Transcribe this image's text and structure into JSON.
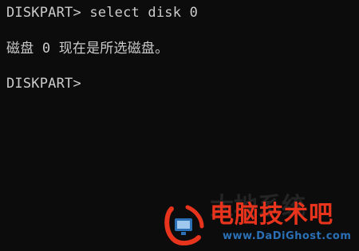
{
  "console": {
    "lines": [
      "DISKPART> select disk 0",
      "磁盘 0 现在是所选磁盘。",
      "DISKPART> "
    ]
  },
  "watermark": {
    "brand_text": "电脑技术吧",
    "url_text": "www.DaDiGhost.com",
    "ghost_text": "大地系统",
    "colors": {
      "brand": "#e8341c",
      "url": "#2b6fb5"
    },
    "icon": "dadi-logo-icon"
  }
}
